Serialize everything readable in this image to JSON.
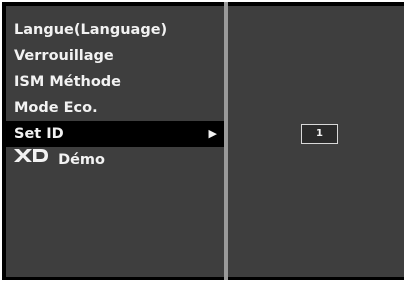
{
  "menu": {
    "items": [
      {
        "label": "Langue(Language)",
        "selected": false
      },
      {
        "label": "Verrouillage",
        "selected": false
      },
      {
        "label": "ISM Méthode",
        "selected": false
      },
      {
        "label": "Mode Eco.",
        "selected": false
      },
      {
        "label": "Set ID",
        "selected": true
      },
      {
        "label": "Démo",
        "selected": false,
        "logo": "XD"
      }
    ],
    "submenu_arrow": "▶"
  },
  "set_id": {
    "value": "1"
  },
  "colors": {
    "panel": "#3e3e3e",
    "selected_row": "#000000",
    "text": "#f2f2f2",
    "separator": "#9a9a9a"
  }
}
